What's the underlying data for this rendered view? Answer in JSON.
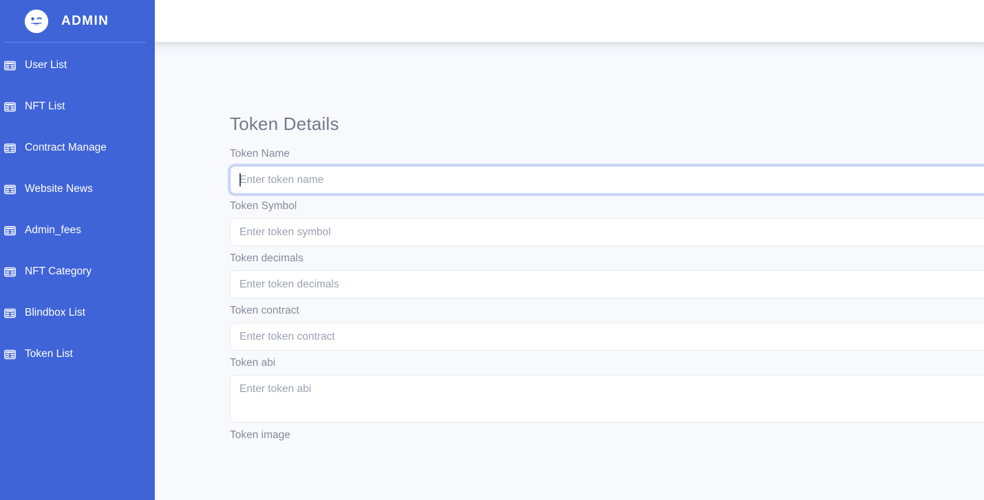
{
  "sidebar": {
    "brand": {
      "title": "ADMIN",
      "logo_icon": "winking-smiley-icon"
    },
    "items": [
      {
        "label": "User List",
        "icon": "table-grid-icon"
      },
      {
        "label": "NFT List",
        "icon": "table-grid-icon"
      },
      {
        "label": "Contract Manage",
        "icon": "table-grid-icon"
      },
      {
        "label": "Website News",
        "icon": "table-grid-icon"
      },
      {
        "label": "Admin_fees",
        "icon": "table-grid-icon"
      },
      {
        "label": "NFT Category",
        "icon": "table-grid-icon"
      },
      {
        "label": "Blindbox List",
        "icon": "table-grid-icon"
      },
      {
        "label": "Token List",
        "icon": "table-grid-icon"
      }
    ]
  },
  "topbar": {
    "content": ""
  },
  "main": {
    "title": "Token Details",
    "fields": [
      {
        "label": "Token Name",
        "placeholder": "Enter token name",
        "value": "",
        "type": "input",
        "focused": true
      },
      {
        "label": "Token Symbol",
        "placeholder": "Enter token symbol",
        "value": "",
        "type": "input",
        "focused": false
      },
      {
        "label": "Token decimals",
        "placeholder": "Enter token decimals",
        "value": "",
        "type": "input",
        "focused": false
      },
      {
        "label": "Token contract",
        "placeholder": "Enter token contract",
        "value": "",
        "type": "input",
        "focused": false
      },
      {
        "label": "Token abi",
        "placeholder": "Enter token abi",
        "value": "",
        "type": "textarea",
        "focused": false
      },
      {
        "label": "Token image",
        "placeholder": "",
        "value": "",
        "type": "label-only",
        "focused": false
      }
    ]
  },
  "colors": {
    "sidebar_bg": "#3f64d8",
    "topbar_bg": "#ffffff",
    "content_bg": "#f8f9fc",
    "title_text": "#707a8c",
    "label_text": "#838c9c",
    "placeholder_text": "#9aa2b1",
    "input_border": "#e6e8ee",
    "focus_ring": "#b9c6ef"
  }
}
